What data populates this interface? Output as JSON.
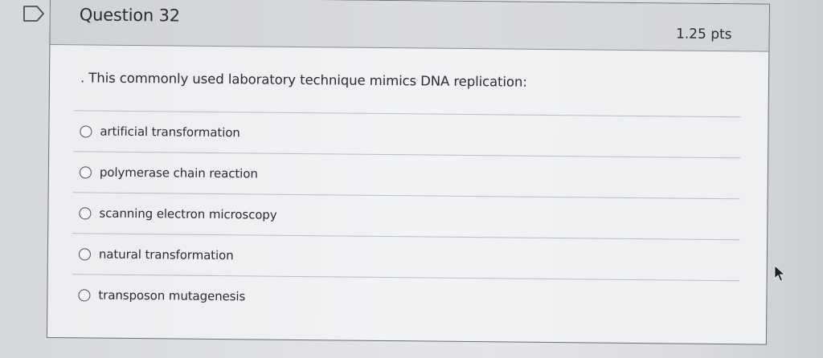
{
  "question": {
    "title": "Question 32",
    "points": "1.25 pts",
    "prompt": ". This commonly used laboratory technique mimics DNA replication:"
  },
  "answers": [
    {
      "label": "artificial transformation",
      "selected": false
    },
    {
      "label": "polymerase chain reaction",
      "selected": false
    },
    {
      "label": "scanning electron microscopy",
      "selected": false
    },
    {
      "label": "natural transformation",
      "selected": false
    },
    {
      "label": "transposon mutagenesis",
      "selected": false
    }
  ],
  "icons": {
    "flag": "flag-icon",
    "cursor": "mouse-cursor-icon"
  },
  "colors": {
    "text": "#2a2c31",
    "header_bg": "#d4d7dc",
    "card_bg": "#eff0f2"
  }
}
